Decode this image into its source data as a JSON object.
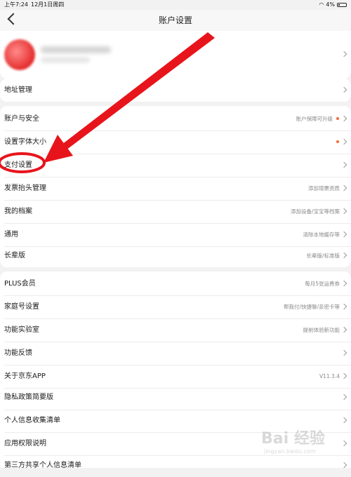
{
  "status_bar": {
    "time": "上午7:24",
    "date": "12月1日周四",
    "battery": "4%"
  },
  "nav": {
    "title": "账户设置"
  },
  "address": {
    "label": "地址管理"
  },
  "group1": [
    {
      "label": "账户与安全",
      "hint": "账户保障可升级",
      "dot": true
    },
    {
      "label": "设置字体大小",
      "hint": "",
      "dot": true
    },
    {
      "label": "支付设置",
      "hint": "",
      "dot": false
    },
    {
      "label": "发票抬头管理",
      "hint": "添加增票资质",
      "dot": false
    },
    {
      "label": "我的档案",
      "hint": "添加设备/宝宝等档案",
      "dot": false
    },
    {
      "label": "通用",
      "hint": "清除本地缓存等",
      "dot": false
    },
    {
      "label": "长辈版",
      "hint": "长辈版/标准版",
      "dot": false
    }
  ],
  "group2": [
    {
      "label": "PLUS会员",
      "hint": "每月5张运费券"
    },
    {
      "label": "家庭号设置",
      "hint": "帮我付/快捷聊/亲密卡等"
    },
    {
      "label": "功能实验室",
      "hint": "提前体验新功能"
    },
    {
      "label": "功能反馈",
      "hint": ""
    },
    {
      "label": "关于京东APP",
      "hint": "V11.3.4"
    },
    {
      "label": "隐私政策简要版",
      "hint": ""
    },
    {
      "label": "个人信息收集清单",
      "hint": ""
    },
    {
      "label": "应用权限说明",
      "hint": ""
    },
    {
      "label": "第三方共享个人信息清单",
      "hint": ""
    }
  ],
  "watermark": {
    "main": "Bai 经验",
    "sub": "jingyan.baidu.com"
  },
  "colors": {
    "annotation_red": "#e8141c",
    "dot": "#f06a3c"
  }
}
